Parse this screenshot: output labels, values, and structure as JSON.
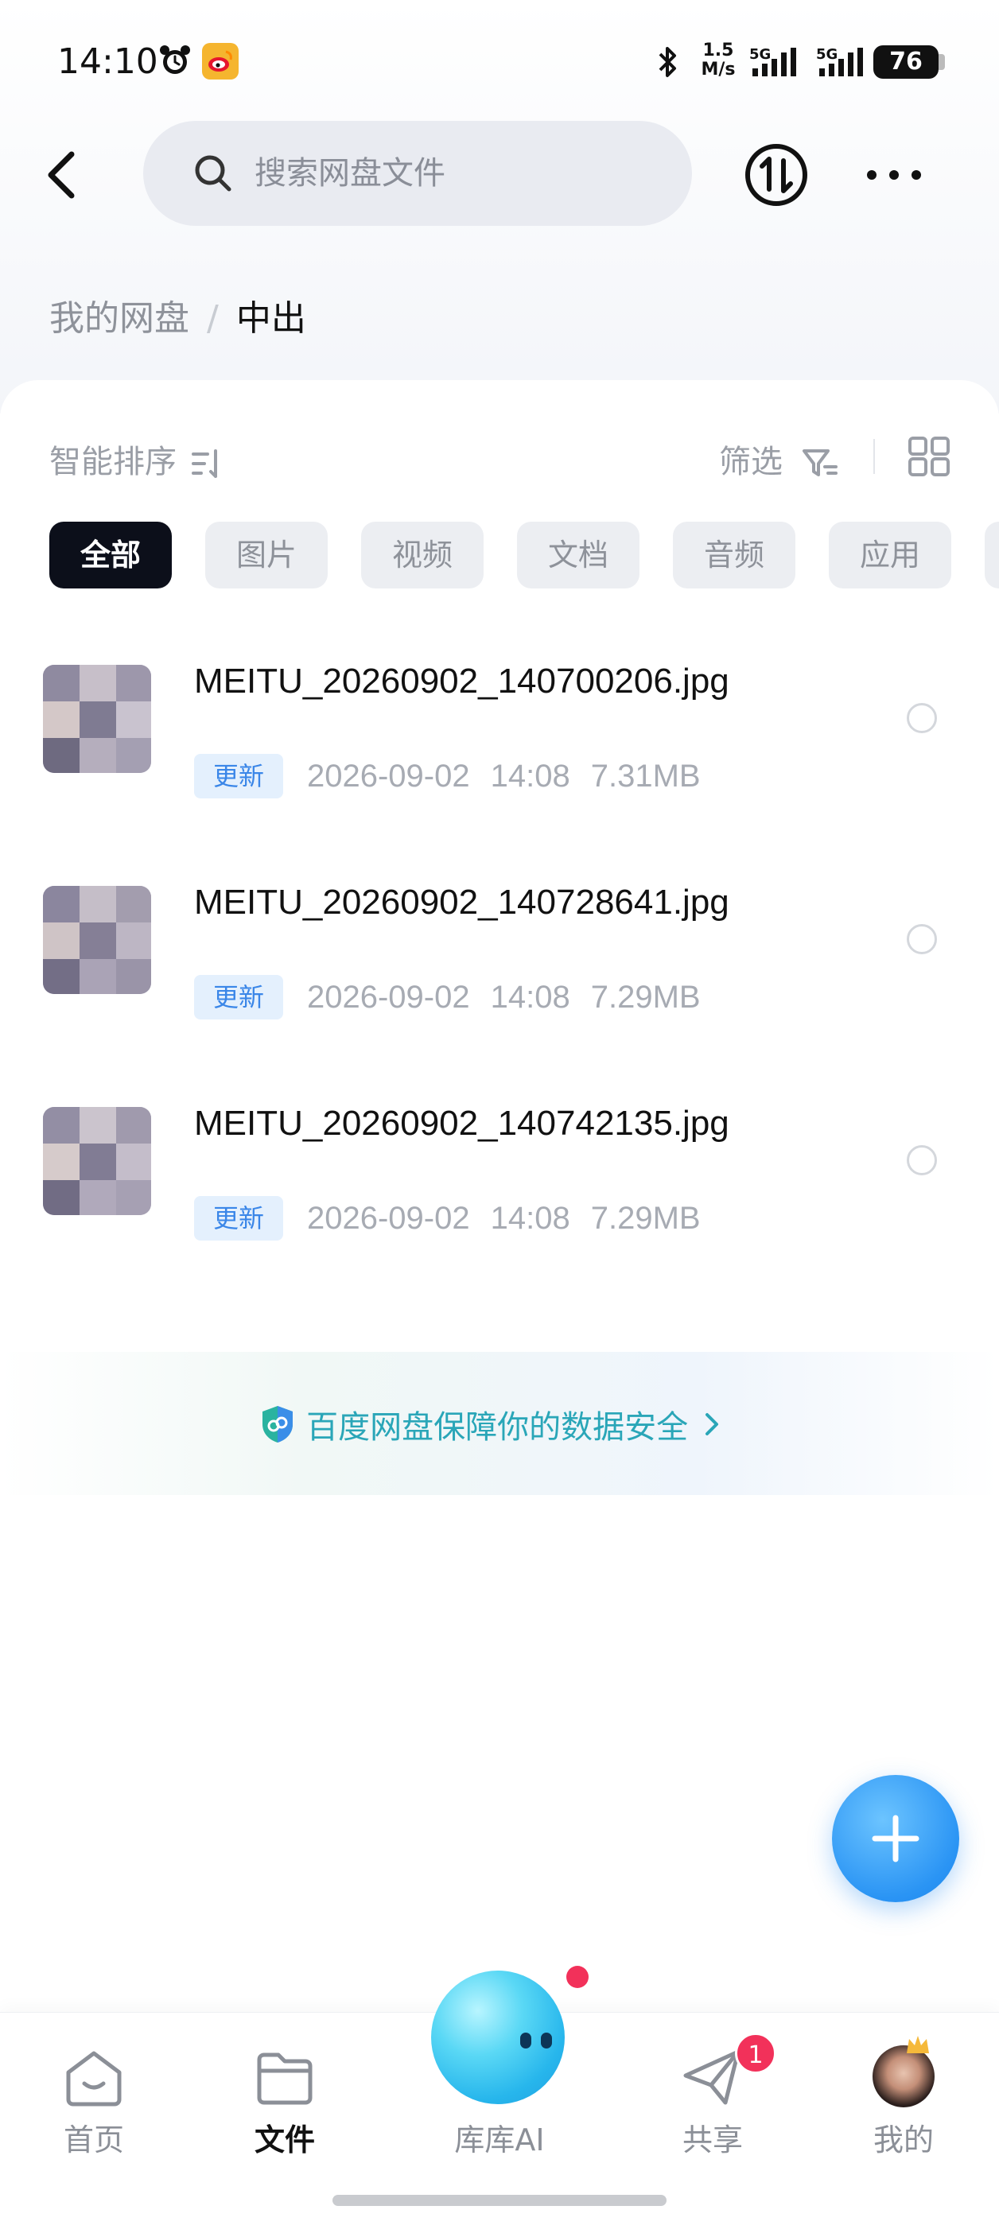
{
  "status_bar": {
    "time": "14:10",
    "net_speed_value": "1.5",
    "net_speed_unit": "M/s",
    "signal_1": "5G",
    "signal_2": "5G",
    "battery": "76"
  },
  "header": {
    "search_placeholder": "搜索网盘文件",
    "back_icon": "chevron-left-icon",
    "transfer_icon": "transfer-icon",
    "more_icon": "more-dots-icon"
  },
  "breadcrumb": {
    "root": "我的网盘",
    "separator": "/",
    "current": "中出"
  },
  "toolbar": {
    "sort_label": "智能排序",
    "filter_label": "筛选"
  },
  "categories": [
    {
      "label": "全部",
      "active": true
    },
    {
      "label": "图片",
      "active": false
    },
    {
      "label": "视频",
      "active": false
    },
    {
      "label": "文档",
      "active": false
    },
    {
      "label": "音频",
      "active": false
    },
    {
      "label": "应用",
      "active": false
    }
  ],
  "files": [
    {
      "name": "MEITU_20260902_140700206.jpg",
      "badge": "更新",
      "date": "2026-09-02",
      "time": "14:08",
      "size": "7.31MB"
    },
    {
      "name": "MEITU_20260902_140728641.jpg",
      "badge": "更新",
      "date": "2026-09-02",
      "time": "14:08",
      "size": "7.29MB"
    },
    {
      "name": "MEITU_20260902_140742135.jpg",
      "badge": "更新",
      "date": "2026-09-02",
      "time": "14:08",
      "size": "7.29MB"
    }
  ],
  "security_banner": "百度网盘保障你的数据安全",
  "bottom_nav": {
    "home": "首页",
    "files": "文件",
    "ai": "库库AI",
    "share": "共享",
    "share_badge": "1",
    "mine": "我的",
    "active": "files"
  },
  "colors": {
    "accent_blue": "#2a94f4",
    "badge_blue_bg": "#e4f0fd",
    "badge_blue_text": "#3a86e8",
    "security_teal": "#2aa6b8",
    "notification_red": "#f2315a",
    "active_chip": "#0c0f1a"
  }
}
